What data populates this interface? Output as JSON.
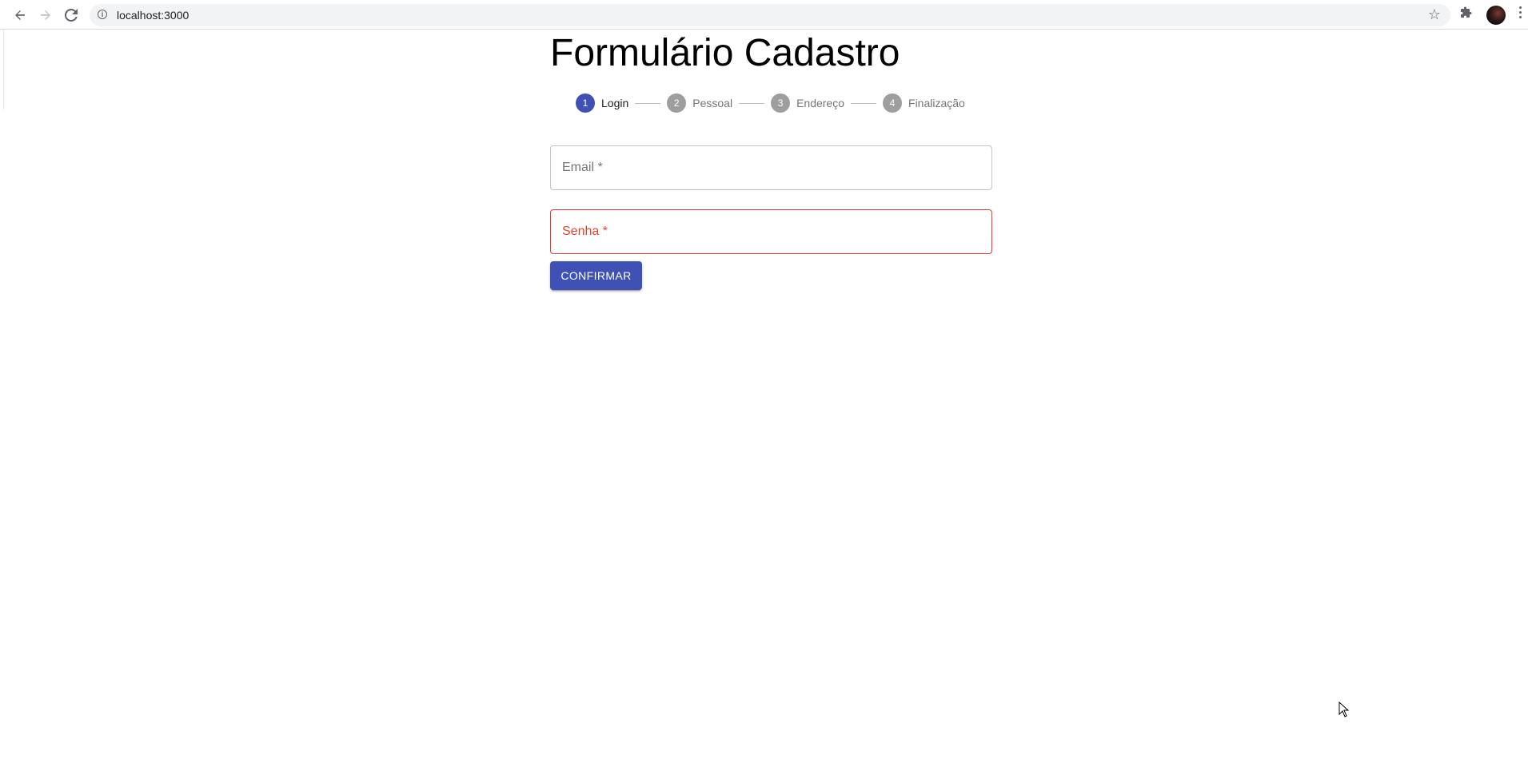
{
  "browser": {
    "url": "localhost:3000"
  },
  "page": {
    "title": "Formulário Cadastro"
  },
  "stepper": {
    "steps": [
      {
        "number": "1",
        "label": "Login",
        "active": true
      },
      {
        "number": "2",
        "label": "Pessoal",
        "active": false
      },
      {
        "number": "3",
        "label": "Endereço",
        "active": false
      },
      {
        "number": "4",
        "label": "Finalização",
        "active": false
      }
    ]
  },
  "form": {
    "email_label": "Email *",
    "email_value": "",
    "password_label": "Senha *",
    "password_value": "",
    "password_error": true,
    "confirm_label": "CONFIRMAR"
  },
  "colors": {
    "primary": "#3f51b5",
    "error": "#e53935",
    "inactive_step": "#9e9e9e"
  }
}
